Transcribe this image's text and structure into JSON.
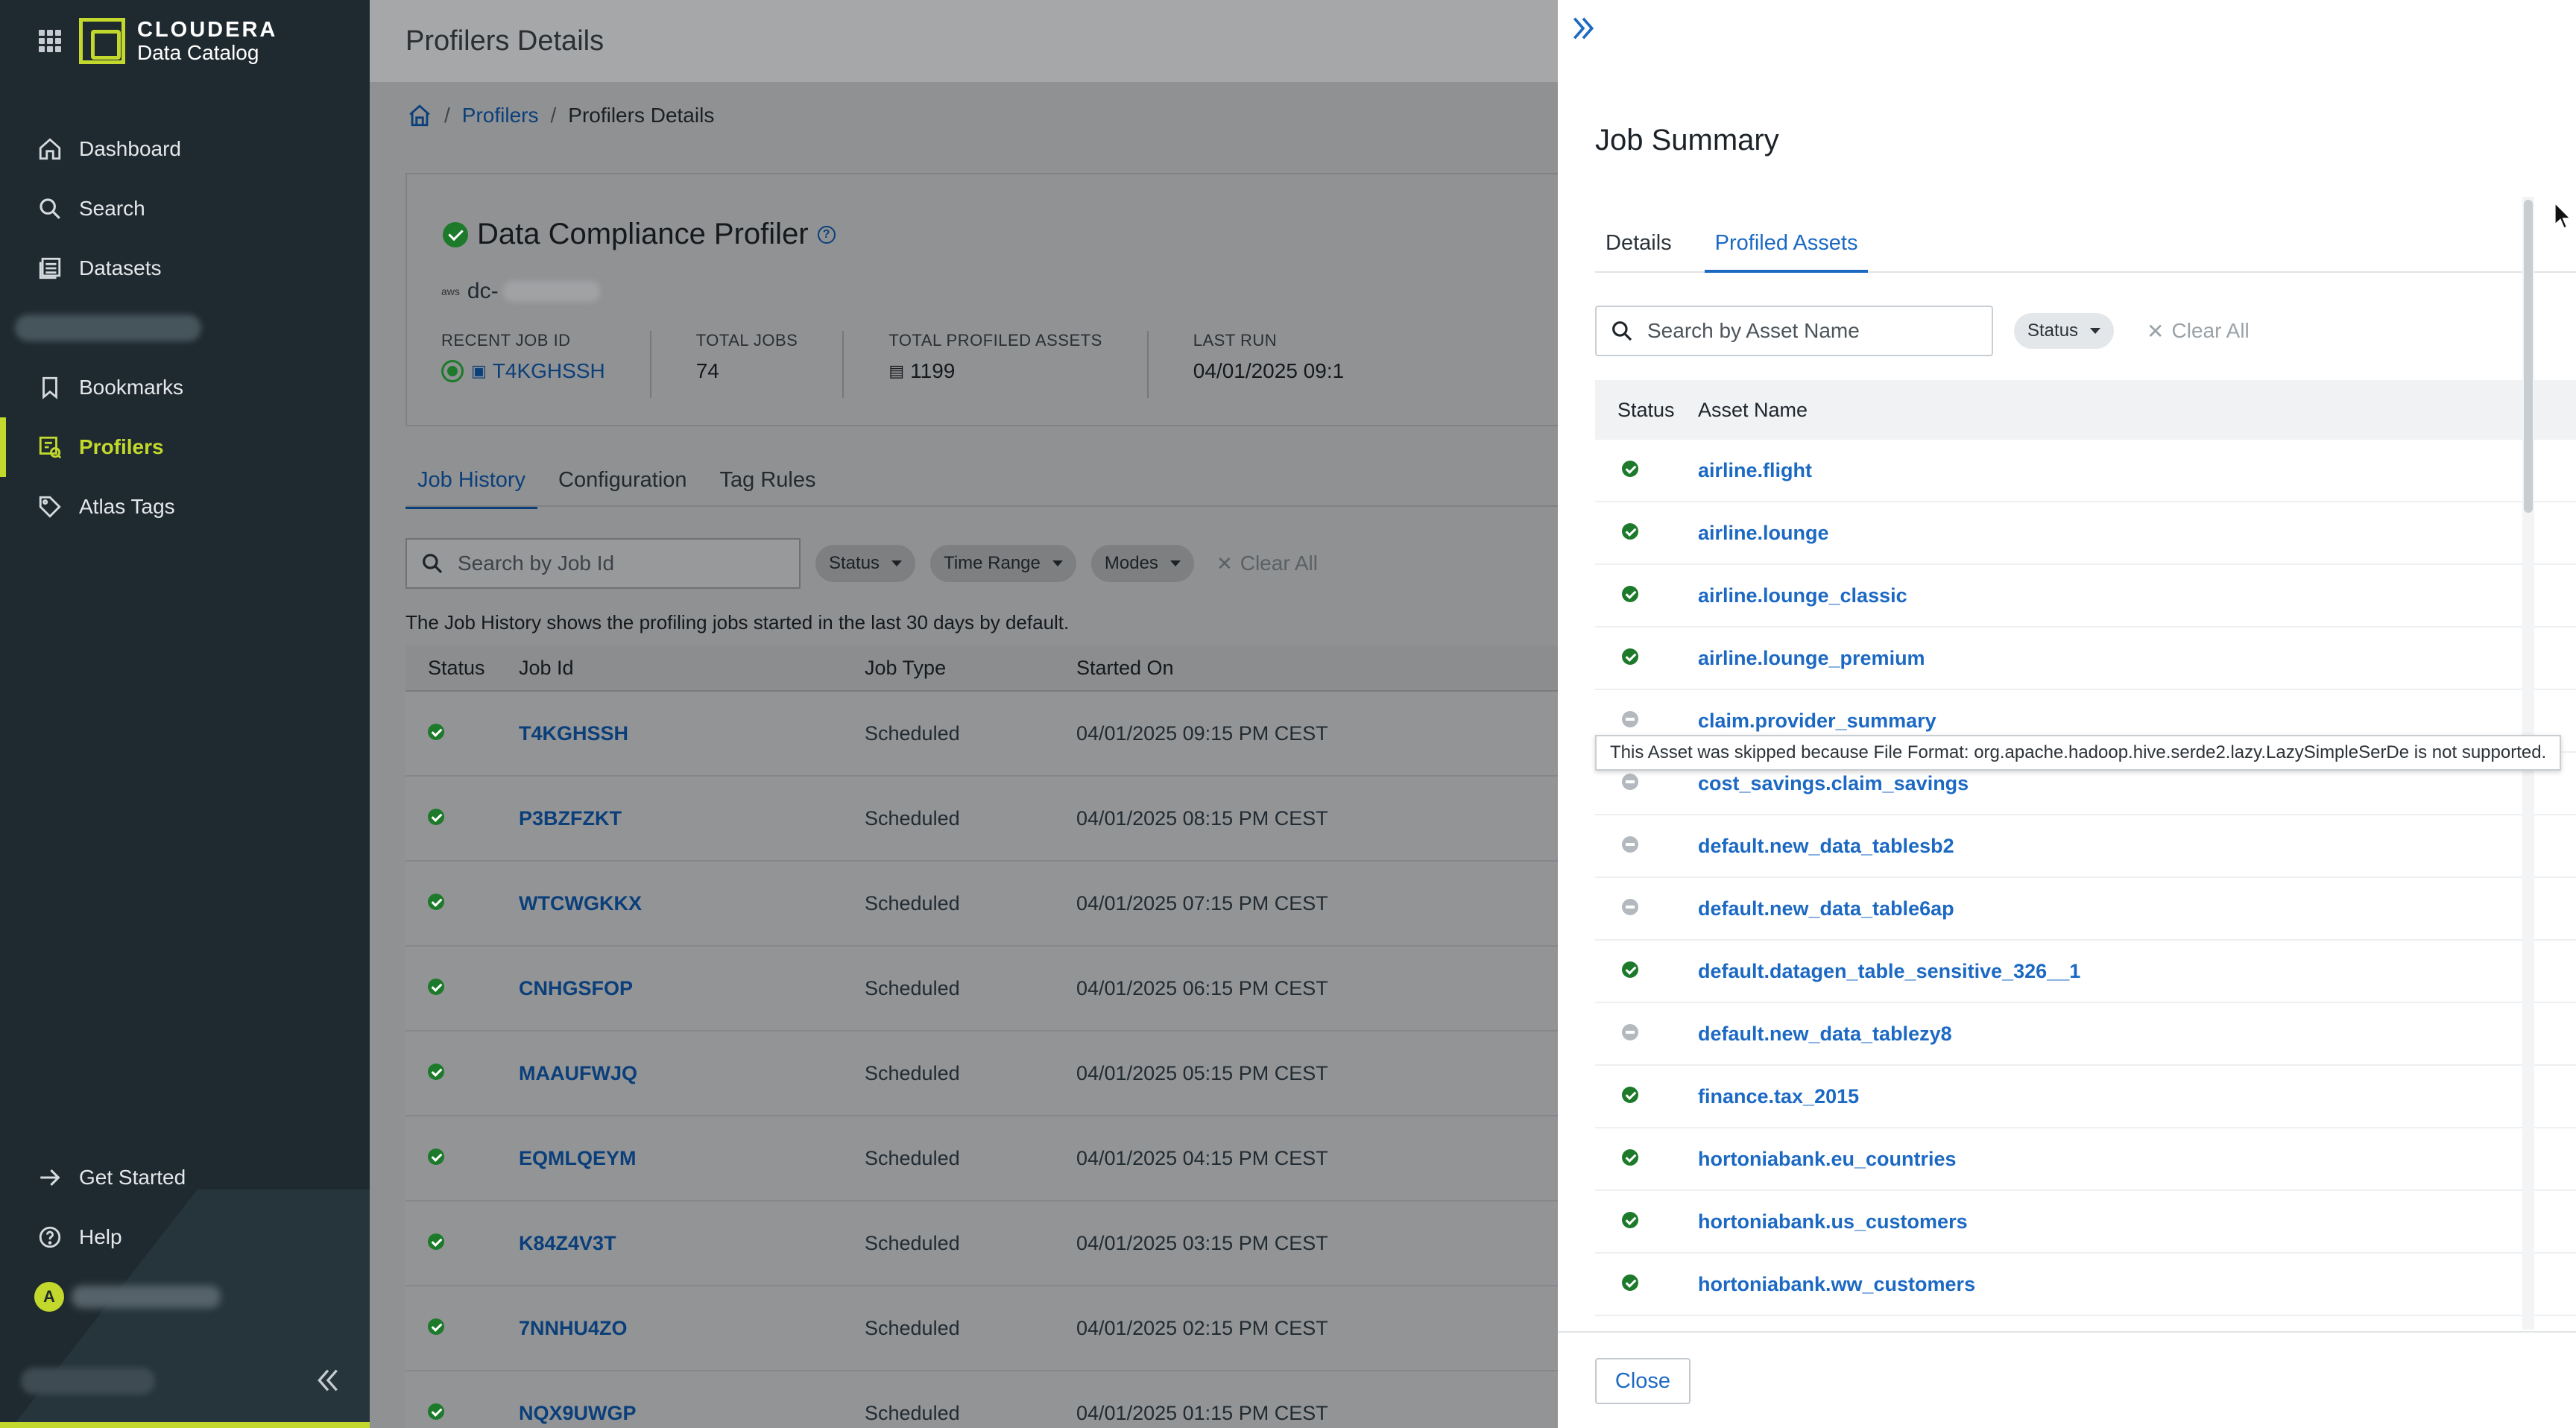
{
  "app": {
    "brand": "CLOUDERA",
    "product": "Data Catalog"
  },
  "sidebar": {
    "items": [
      {
        "label": "Dashboard",
        "icon": "home-icon"
      },
      {
        "label": "Search",
        "icon": "search-icon"
      },
      {
        "label": "Datasets",
        "icon": "dataset-icon"
      },
      {
        "label": "Bookmarks",
        "icon": "bookmark-icon"
      },
      {
        "label": "Profilers",
        "icon": "profiler-icon",
        "active": true
      },
      {
        "label": "Atlas Tags",
        "icon": "tag-icon"
      }
    ],
    "bottom": [
      {
        "label": "Get Started",
        "icon": "arrow-right-icon"
      },
      {
        "label": "Help",
        "icon": "help-icon"
      }
    ],
    "avatar_initial": "A",
    "accent_color": "#c2d82c"
  },
  "main": {
    "header_title": "Profilers Details",
    "breadcrumb": {
      "link": "Profilers",
      "current": "Profilers Details"
    },
    "profiler": {
      "name": "Data Compliance Profiler",
      "cloud_prefix": "aws",
      "id_prefix": "dc-",
      "recent_job_label": "RECENT JOB ID",
      "recent_job_id": "T4KGHSSH",
      "total_jobs_label": "TOTAL JOBS",
      "total_jobs": "74",
      "total_assets_label": "TOTAL PROFILED ASSETS",
      "total_assets": "1199",
      "last_run_label": "LAST RUN",
      "last_run": "04/01/2025 09:1"
    },
    "tabs": [
      "Job History",
      "Configuration",
      "Tag Rules"
    ],
    "filters": {
      "search_placeholder": "Search by Job Id",
      "status": "Status",
      "time_range": "Time Range",
      "modes": "Modes",
      "clear_all": "Clear All"
    },
    "history_note": "The Job History shows the profiling jobs started in the last 30 days by default.",
    "columns": [
      "Status",
      "Job Id",
      "Job Type",
      "Started On"
    ],
    "jobs": [
      {
        "id": "T4KGHSSH",
        "type": "Scheduled",
        "started": "04/01/2025 09:15 PM CEST"
      },
      {
        "id": "P3BZFZKT",
        "type": "Scheduled",
        "started": "04/01/2025 08:15 PM CEST"
      },
      {
        "id": "WTCWGKKX",
        "type": "Scheduled",
        "started": "04/01/2025 07:15 PM CEST"
      },
      {
        "id": "CNHGSFOP",
        "type": "Scheduled",
        "started": "04/01/2025 06:15 PM CEST"
      },
      {
        "id": "MAAUFWJQ",
        "type": "Scheduled",
        "started": "04/01/2025 05:15 PM CEST"
      },
      {
        "id": "EQMLQEYM",
        "type": "Scheduled",
        "started": "04/01/2025 04:15 PM CEST"
      },
      {
        "id": "K84Z4V3T",
        "type": "Scheduled",
        "started": "04/01/2025 03:15 PM CEST"
      },
      {
        "id": "7NNHU4ZO",
        "type": "Scheduled",
        "started": "04/01/2025 02:15 PM CEST"
      },
      {
        "id": "NQX9UWGP",
        "type": "Scheduled",
        "started": "04/01/2025 01:15 PM CEST"
      }
    ]
  },
  "drawer": {
    "title": "Job Summary",
    "tabs": [
      "Details",
      "Profiled Assets"
    ],
    "search_placeholder": "Search by Asset Name",
    "status_filter": "Status",
    "clear_all": "Clear All",
    "columns": [
      "Status",
      "Asset Name"
    ],
    "assets": [
      {
        "name": "airline.flight",
        "status": "success"
      },
      {
        "name": "airline.lounge",
        "status": "success"
      },
      {
        "name": "airline.lounge_classic",
        "status": "success"
      },
      {
        "name": "airline.lounge_premium",
        "status": "success"
      },
      {
        "name": "claim.provider_summary",
        "status": "skipped"
      },
      {
        "name": "cost_savings.claim_savings",
        "status": "skipped"
      },
      {
        "name": "default.new_data_tablesb2",
        "status": "skipped"
      },
      {
        "name": "default.new_data_table6ap",
        "status": "skipped"
      },
      {
        "name": "default.datagen_table_sensitive_326__1",
        "status": "success"
      },
      {
        "name": "default.new_data_tablezy8",
        "status": "skipped"
      },
      {
        "name": "finance.tax_2015",
        "status": "success"
      },
      {
        "name": "hortoniabank.eu_countries",
        "status": "success"
      },
      {
        "name": "hortoniabank.us_customers",
        "status": "success"
      },
      {
        "name": "hortoniabank.ww_customers",
        "status": "success"
      }
    ],
    "tooltip": "This Asset was skipped because File Format: org.apache.hadoop.hive.serde2.lazy.LazySimpleSerDe is not supported.",
    "close_label": "Close",
    "accent_color": "#1c69c3"
  }
}
